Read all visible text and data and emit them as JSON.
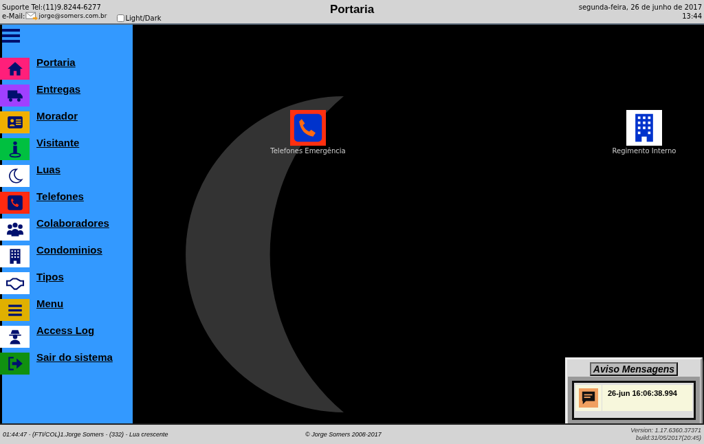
{
  "header": {
    "support": "Suporte Tel:(11)9.8244-6277",
    "email_label": "e-Mail:",
    "email": "jorge@somers.com.br",
    "theme_toggle": {
      "label": "Light/Dark",
      "checked": false
    },
    "title": "Portaria",
    "date": "segunda-feira, 26 de junho de 2017",
    "time": "13:44"
  },
  "sidebar": {
    "items": [
      {
        "label": "Portaria",
        "color": "#ff1f7a"
      },
      {
        "label": "Entregas",
        "color": "#a040ff"
      },
      {
        "label": "Morador",
        "color": "#f0b000"
      },
      {
        "label": "Visitante",
        "color": "#00c040"
      },
      {
        "label": "Luas",
        "color": "#ffffff"
      },
      {
        "label": "Telefones",
        "color": "#ff2a10"
      },
      {
        "label": "Colaboradores",
        "color": "#ffffff"
      },
      {
        "label": "Condominios",
        "color": "#ffffff"
      },
      {
        "label": "Tipos",
        "color": "#ffffff"
      },
      {
        "label": "Menu",
        "color": "#e0b000"
      },
      {
        "label": "Access Log",
        "color": "#ffffff"
      },
      {
        "label": "Sair do sistema",
        "color": "#109010"
      }
    ]
  },
  "desktop": {
    "shortcuts": [
      {
        "label": "Telefones Emergência"
      },
      {
        "label": "Regimento Interno"
      }
    ]
  },
  "messages": {
    "title": "Aviso Mensagens",
    "items": [
      {
        "time": "26-jun 16:06:38.994"
      }
    ]
  },
  "status_bar": {
    "left": "01:44:47 - (FTI/COL)1.Jorge Somers - (332) - Lua crescente",
    "center": "© Jorge Somers 2008-2017",
    "version": "Version: 1.17.6360.37371",
    "build": "build:31/05/2017(20:45)"
  }
}
